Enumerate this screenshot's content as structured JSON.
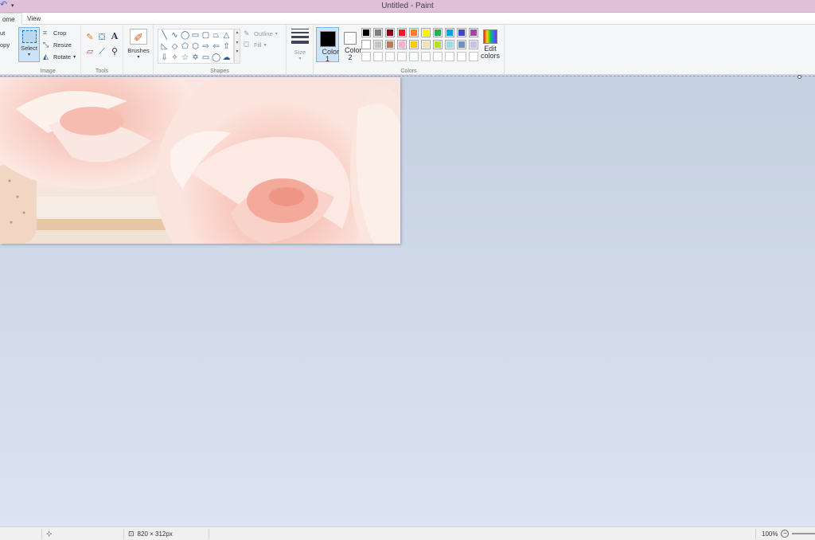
{
  "window": {
    "title": "Untitled - Paint"
  },
  "tabs": [
    {
      "label": "ome"
    },
    {
      "label": "View"
    }
  ],
  "clipboard": {
    "cut_label": "ut",
    "copy_label": "opy"
  },
  "image_group": {
    "label": "Image",
    "select_label": "Select",
    "crop_label": "Crop",
    "resize_label": "Resize",
    "rotate_label": "Rotate"
  },
  "tools_group": {
    "label": "Tools"
  },
  "brushes": {
    "label": "Brushes"
  },
  "shapes_group": {
    "label": "Shapes",
    "outline_label": "Outline",
    "fill_label": "Fill"
  },
  "size": {
    "label": "Size"
  },
  "colors_group": {
    "label": "Colors",
    "color1_label": "Color 1",
    "color2_label": "Color 2",
    "edit_label": "Edit colors",
    "color1": "#000000",
    "color2": "#ffffff",
    "row1": [
      "#000000",
      "#7f7f7f",
      "#880015",
      "#ed1c24",
      "#ff7f27",
      "#fff200",
      "#22b14c",
      "#00a2e8",
      "#3f48cc",
      "#a349a4"
    ],
    "row2": [
      "#ffffff",
      "#c3c3c3",
      "#b97a57",
      "#ffaec9",
      "#ffc90e",
      "#efe4b0",
      "#b5e61d",
      "#99d9ea",
      "#7092be",
      "#c8bfe7"
    ],
    "row3": [
      "#ffffff",
      "#ffffff",
      "#ffffff",
      "#ffffff",
      "#ffffff",
      "#ffffff",
      "#ffffff",
      "#ffffff",
      "#ffffff",
      "#ffffff"
    ]
  },
  "status": {
    "dimensions": "820 × 312px",
    "zoom": "100%"
  }
}
